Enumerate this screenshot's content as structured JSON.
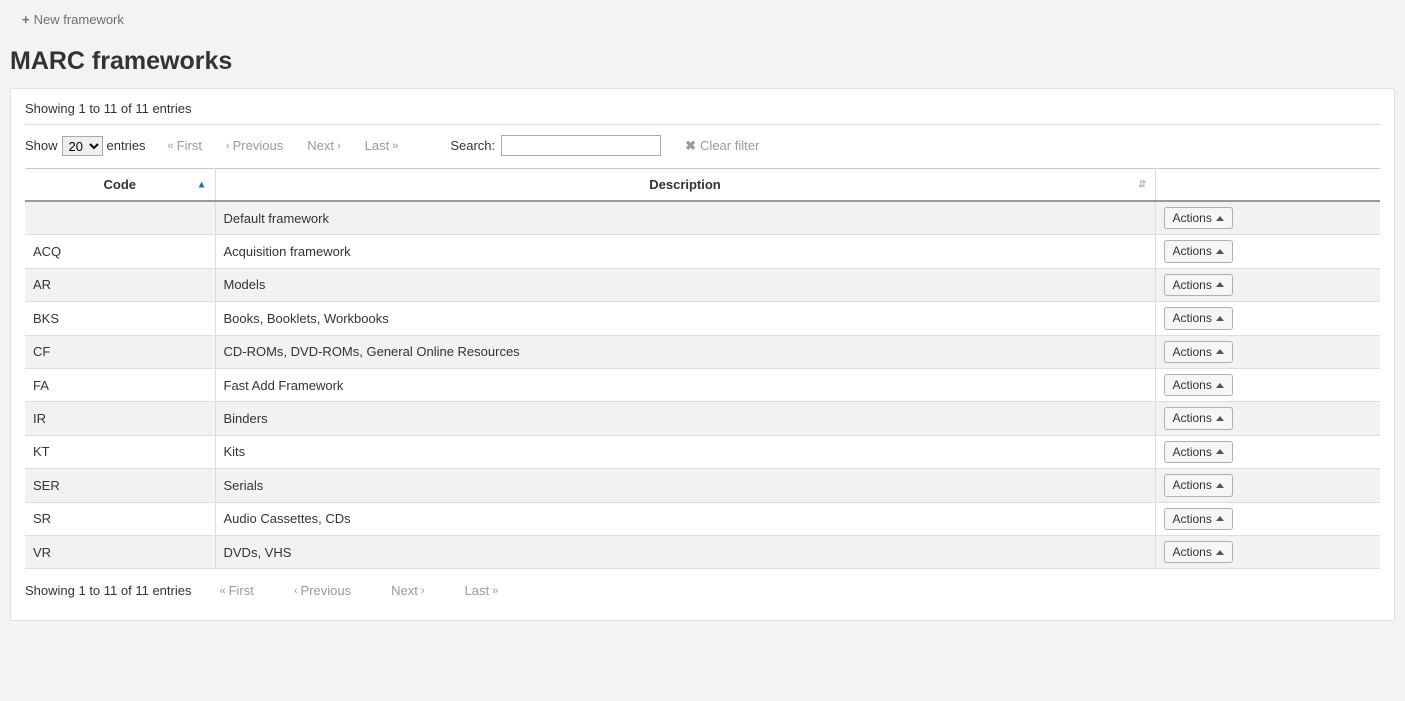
{
  "toolbar": {
    "new_framework_label": "New framework"
  },
  "page_title": "MARC frameworks",
  "table_info": "Showing 1 to 11 of 11 entries",
  "length_menu": {
    "show_label": "Show",
    "entries_label": "entries",
    "value": "20"
  },
  "pager": {
    "first": "First",
    "previous": "Previous",
    "next": "Next",
    "last": "Last"
  },
  "search": {
    "label": "Search:",
    "value": ""
  },
  "clear_filter_label": "Clear filter",
  "columns": {
    "code": "Code",
    "description": "Description"
  },
  "actions_label": "Actions",
  "rows": [
    {
      "code": "",
      "description": "Default framework"
    },
    {
      "code": "ACQ",
      "description": "Acquisition framework"
    },
    {
      "code": "AR",
      "description": "Models"
    },
    {
      "code": "BKS",
      "description": "Books, Booklets, Workbooks"
    },
    {
      "code": "CF",
      "description": "CD-ROMs, DVD-ROMs, General Online Resources"
    },
    {
      "code": "FA",
      "description": "Fast Add Framework"
    },
    {
      "code": "IR",
      "description": "Binders"
    },
    {
      "code": "KT",
      "description": "Kits"
    },
    {
      "code": "SER",
      "description": "Serials"
    },
    {
      "code": "SR",
      "description": "Audio Cassettes, CDs"
    },
    {
      "code": "VR",
      "description": "DVDs, VHS"
    }
  ]
}
